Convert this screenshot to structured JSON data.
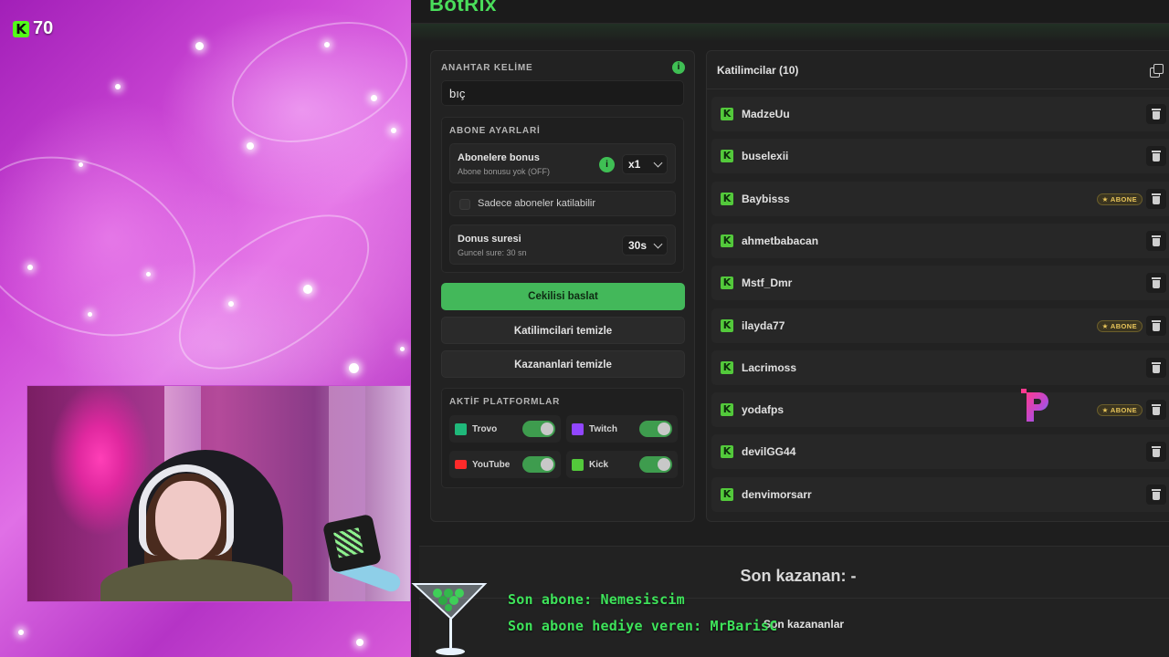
{
  "stream": {
    "kick_viewers": "70"
  },
  "app": {
    "title": "BotRix"
  },
  "settings": {
    "keyword_label": "ANAHTAR KELİME",
    "keyword_value": "bıç",
    "subscriber_section_label": "ABONE AYARLARİ",
    "subscriber_bonus_title": "Abonelere bonus",
    "subscriber_bonus_sub": "Abone bonusu yok (OFF)",
    "subscriber_bonus_multiplier": "x1",
    "subs_only_label": "Sadece aboneler katilabilir",
    "spin_time_title": "Donus suresi",
    "spin_time_sub": "Guncel sure: 30 sn",
    "spin_time_value": "30s",
    "start_button": "Cekilisi baslat",
    "clear_participants_button": "Katilimcilari temizle",
    "clear_winners_button": "Kazananlari temizle",
    "platforms_label": "AKTİF PLATFORMLAR",
    "platforms": [
      {
        "name": "Trovo",
        "icon": "trovo-icon",
        "color": "#1fb87a"
      },
      {
        "name": "Twitch",
        "icon": "twitch-icon",
        "color": "#9146ff"
      },
      {
        "name": "YouTube",
        "icon": "youtube-icon",
        "color": "#ff2a2a"
      },
      {
        "name": "Kick",
        "icon": "kick-icon",
        "color": "#53c93b"
      }
    ]
  },
  "participants": {
    "title": "Katilimcilar (10)",
    "badge_label": "★ ABONE",
    "items": [
      {
        "name": "MadzeUu",
        "subscriber": false
      },
      {
        "name": "buselexii",
        "subscriber": false
      },
      {
        "name": "Baybisss",
        "subscriber": true
      },
      {
        "name": "ahmetbabacan",
        "subscriber": false
      },
      {
        "name": "Mstf_Dmr",
        "subscriber": false
      },
      {
        "name": "ilayda77",
        "subscriber": true
      },
      {
        "name": "Lacrimoss",
        "subscriber": false
      },
      {
        "name": "yodafps",
        "subscriber": true
      },
      {
        "name": "devilGG44",
        "subscriber": false
      },
      {
        "name": "denvimorsarr",
        "subscriber": false
      }
    ]
  },
  "bottom": {
    "last_winner": "Son kazanan: -",
    "winners_label": "Son kazananlar"
  },
  "overlay": {
    "last_sub": "Son abone: Nemesiscim",
    "last_gifter": "Son abone hediye veren: MrBarisC"
  },
  "colors": {
    "accent_green": "#43b85a",
    "overlay_green": "#3ee35a",
    "badge_gold": "#e8c55a"
  }
}
